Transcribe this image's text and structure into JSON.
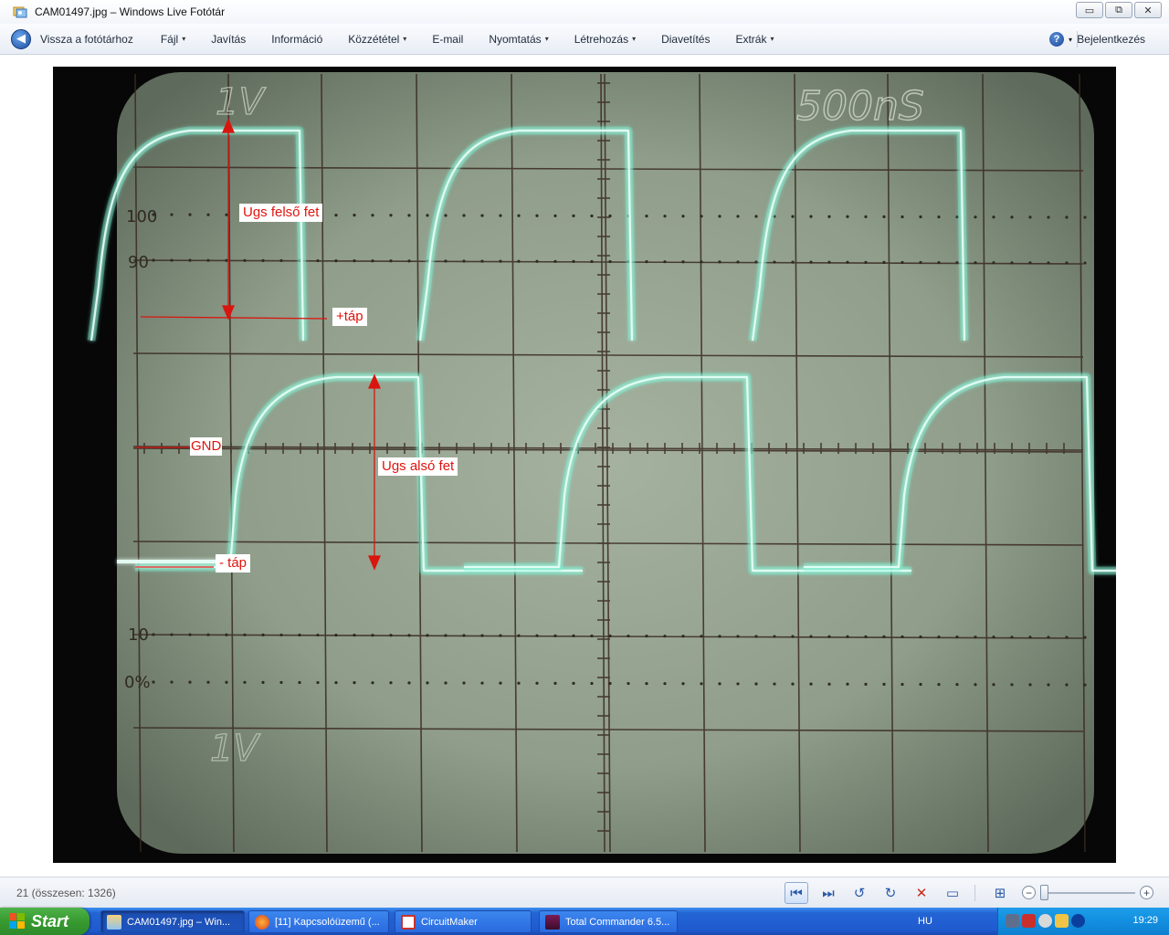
{
  "window": {
    "title": "CAM01497.jpg – Windows Live Fotótár",
    "controls": {
      "minimize": "▭",
      "restore": "⧉",
      "close": "✕"
    }
  },
  "menubar": {
    "back_label": "Vissza a fotótárhoz",
    "items": [
      {
        "label": "Fájl",
        "caret": "▾"
      },
      {
        "label": "Javítás",
        "caret": ""
      },
      {
        "label": "Információ",
        "caret": ""
      },
      {
        "label": "Közzététel",
        "caret": "▾"
      },
      {
        "label": "E-mail",
        "caret": ""
      },
      {
        "label": "Nyomtatás",
        "caret": "▾"
      },
      {
        "label": "Létrehozás",
        "caret": "▾"
      },
      {
        "label": "Diavetítés",
        "caret": ""
      },
      {
        "label": "Extrák",
        "caret": "▾"
      }
    ],
    "help_glyph": "?",
    "help_caret": "▾",
    "signin_label": "Bejelentkezés"
  },
  "photo": {
    "scope_labels": {
      "volts_top": "1V",
      "volts_bottom": "1V",
      "timebase": "500nS",
      "pct_100": "100",
      "pct_90": "90",
      "pct_10": "10",
      "pct_0": "0%"
    },
    "annotations": {
      "ugs_upper": "Ugs felső fet",
      "plus_supply": "+táp",
      "gnd": "GND",
      "ugs_lower": "Ugs alsó fet",
      "minus_supply": "- táp"
    }
  },
  "bottombar": {
    "counter": "21 (összesen: 1326)",
    "zoom_level": 0.0
  },
  "taskbar": {
    "start_label": "Start",
    "tasks": [
      {
        "label": "CAM01497.jpg – Win..."
      },
      {
        "label": "[11] Kapcsolóüzemű (..."
      },
      {
        "label": "CircuitMaker"
      },
      {
        "label": "Total Commander 6.5..."
      }
    ],
    "language": "HU",
    "clock": "19:29"
  },
  "colors": {
    "trace": "#66f2cf",
    "annotation_red": "#e0140e",
    "screen": "#8e9c88",
    "taskbar_blue": "#2364d3",
    "start_green": "#379a30"
  }
}
